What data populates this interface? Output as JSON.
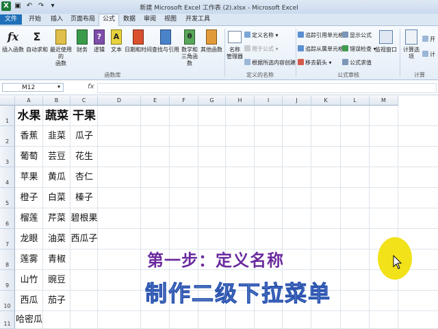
{
  "window": {
    "title": "新建 Microsoft Excel 工作表 (2).xlsx - Microsoft Excel"
  },
  "tabs": [
    {
      "label": "文件"
    },
    {
      "label": "开始"
    },
    {
      "label": "插入"
    },
    {
      "label": "页面布局"
    },
    {
      "label": "公式"
    },
    {
      "label": "数据"
    },
    {
      "label": "审阅"
    },
    {
      "label": "视图"
    },
    {
      "label": "开发工具"
    }
  ],
  "active_tab": "公式",
  "ribbon": {
    "function_library": {
      "insert_function": "插入函数",
      "autosum": "自动求和",
      "recent_line1": "最近使用的",
      "recent_line2": "函数",
      "financial": "财务",
      "logical": "逻辑",
      "text": "文本",
      "datetime": "日期和时间",
      "lookup": "查找与引用",
      "math_line1": "数学和",
      "math_line2": "三角函数",
      "more": "其他函数",
      "group_label": "函数库"
    },
    "defined_names": {
      "name_manager_line1": "名称",
      "name_manager_line2": "管理器",
      "define_name": "定义名称",
      "use_in_formula": "用于公式",
      "create_from_selection": "根据所选内容创建",
      "group_label": "定义的名称"
    },
    "formula_auditing": {
      "trace_precedents": "追踪引用单元格",
      "trace_dependents": "追踪从属单元格",
      "remove_arrows": "移去箭头",
      "show_formulas": "显示公式",
      "error_checking": "错误检查",
      "evaluate_formula": "公式求值",
      "watch_window": "监视窗口",
      "group_label": "公式审核"
    },
    "calculation": {
      "options": "计算选项",
      "calc_now": "开",
      "calc_sheet": "计",
      "group_label": "计算"
    }
  },
  "formula_bar": {
    "name_box": "M12",
    "fx": "fx",
    "formula": ""
  },
  "columns": [
    "A",
    "B",
    "C",
    "D",
    "E",
    "F",
    "G",
    "H",
    "I",
    "J",
    "K",
    "L",
    "M"
  ],
  "rows": [
    "1",
    "2",
    "3",
    "4",
    "5",
    "6",
    "7",
    "8",
    "9",
    "10",
    "11"
  ],
  "cells": {
    "headers": [
      "水果",
      "蔬菜",
      "干果"
    ],
    "col_a": [
      "香蕉",
      "葡萄",
      "苹果",
      "橙子",
      "榴莲",
      "龙眼",
      "莲雾",
      "山竹",
      "西瓜",
      "哈密瓜"
    ],
    "col_b": [
      "韭菜",
      "芸豆",
      "黄瓜",
      "白菜",
      "芹菜",
      "油菜",
      "青椒",
      "豌豆",
      "茄子"
    ],
    "col_c": [
      "瓜子",
      "花生",
      "杏仁",
      "榛子",
      "碧根果",
      "西瓜子"
    ]
  },
  "overlay": {
    "step": "第一步：定义名称",
    "subtitle": "制作二级下拉菜单"
  },
  "colors": {
    "file_tab": "#1e6fb8",
    "step_text": "#6a2a9e",
    "subtitle_fill": "#9ab6e6",
    "subtitle_stroke": "#2c55b0",
    "cursor_highlight": "#f1e21a"
  }
}
